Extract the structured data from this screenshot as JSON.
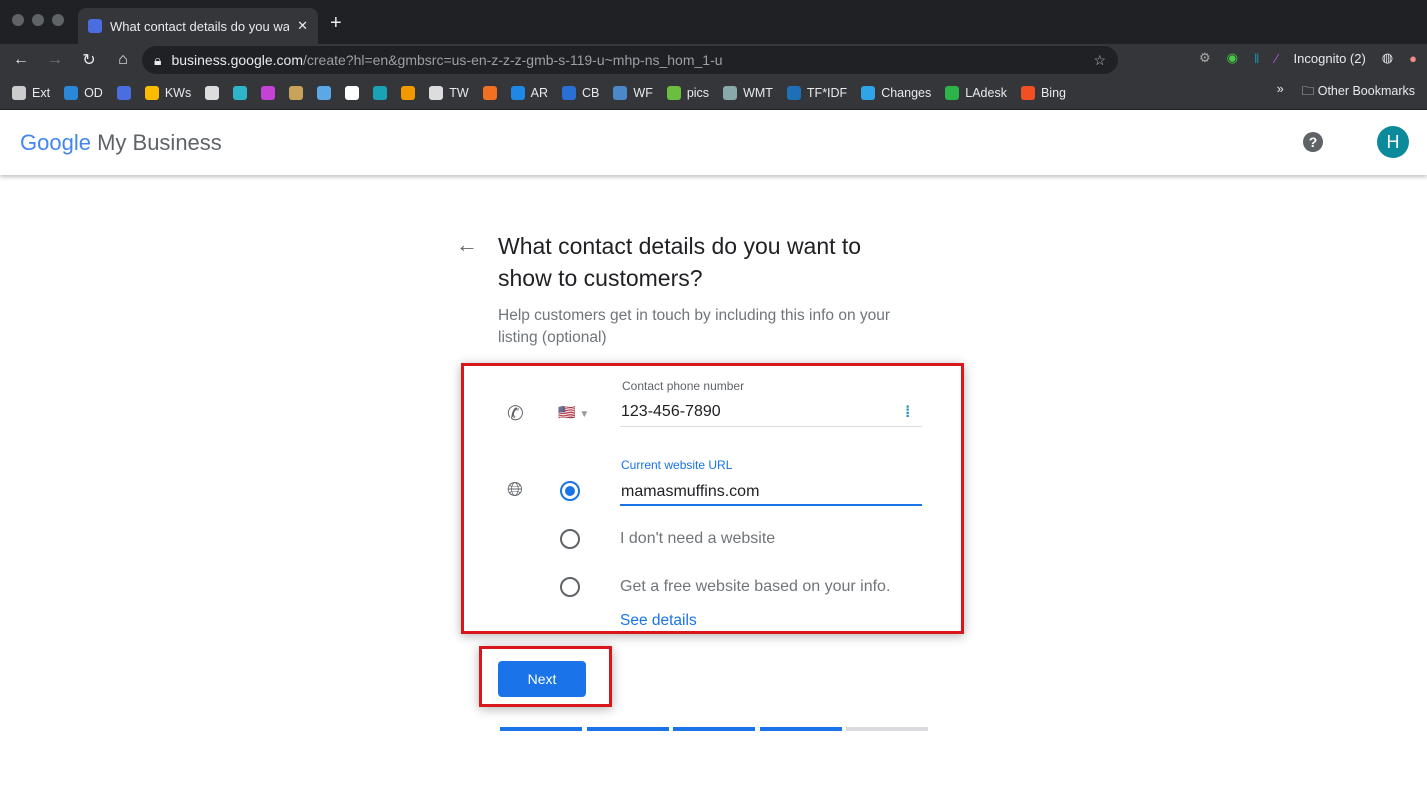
{
  "browser": {
    "tab_title": "What contact details do you want to show to customers?",
    "url_domain": "business.google.com",
    "url_rest": "/create?hl=en&gmbsrc=us-en-z-z-z-gmb-s-119-u~mhp-ns_hom_1-u",
    "incognito": "Incognito (2)",
    "bookmarks": [
      {
        "label": "Ext",
        "color": "#ccc"
      },
      {
        "label": "OD",
        "color": "#2b88d8"
      },
      {
        "label": "",
        "color": "#4a6ee0"
      },
      {
        "label": "KWs",
        "color": "#fbbc04"
      },
      {
        "label": "",
        "color": "#ddd"
      },
      {
        "label": "",
        "color": "#2fb5c9"
      },
      {
        "label": "",
        "color": "#c542d6"
      },
      {
        "label": "",
        "color": "#c9a35a"
      },
      {
        "label": "",
        "color": "#5aa9e6"
      },
      {
        "label": "",
        "color": "#fff"
      },
      {
        "label": "",
        "color": "#1aa3b5"
      },
      {
        "label": "",
        "color": "#f29900"
      },
      {
        "label": "TW",
        "color": "#ddd"
      },
      {
        "label": "",
        "color": "#f36f21"
      },
      {
        "label": "AR",
        "color": "#1e88e5"
      },
      {
        "label": "CB",
        "color": "#2a6fd6"
      },
      {
        "label": "WF",
        "color": "#4a88c8"
      },
      {
        "label": "pics",
        "color": "#6abf40"
      },
      {
        "label": "WMT",
        "color": "#8aa"
      },
      {
        "label": "TF*IDF",
        "color": "#1d6fb8"
      },
      {
        "label": "Changes",
        "color": "#2fa4e7"
      },
      {
        "label": "LAdesk",
        "color": "#2cb34a"
      },
      {
        "label": "Bing",
        "color": "#f25022"
      }
    ],
    "more": "»",
    "other_bookmarks": "Other Bookmarks"
  },
  "header": {
    "logo_google": "Google",
    "logo_rest": "My Business",
    "help": "?",
    "avatar": "H"
  },
  "main": {
    "title": "What contact details do you want to show to customers?",
    "subtitle": "Help customers get in touch by including this info on your listing (optional)",
    "phone_label": "Contact phone number",
    "phone_value": "123-456-7890",
    "country_flag": "🇺🇸",
    "website_label": "Current website URL",
    "website_value": "mamasmuffins.com",
    "options": [
      "I don't need a website",
      "Get a free website based on your info."
    ],
    "see_details": "See details",
    "next": "Next",
    "progress": {
      "completed_steps": 4,
      "total_steps": 5
    }
  },
  "colors": {
    "accent": "#1a73e8",
    "highlight": "#d9161c"
  }
}
